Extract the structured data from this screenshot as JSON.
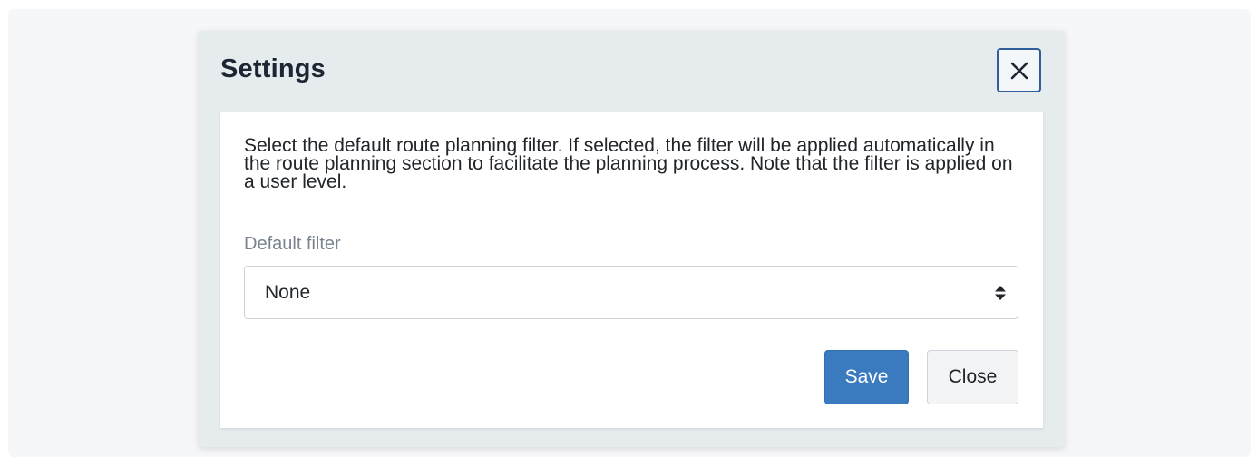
{
  "modal": {
    "title": "Settings",
    "close_icon": "close-x-icon",
    "description": "Select the default route planning filter. If selected, the filter will be applied automatically in the route planning section to facilitate the planning process. Note that the filter is applied on a user level.",
    "field_label": "Default filter",
    "select": {
      "selected_value": "None",
      "icon": "select-updown-arrows-icon"
    },
    "buttons": {
      "save_label": "Save",
      "close_label": "Close"
    }
  },
  "colors": {
    "primary": "#3a7bbf",
    "header_background": "#e6ebee",
    "focus_border": "#2f5f9a"
  }
}
